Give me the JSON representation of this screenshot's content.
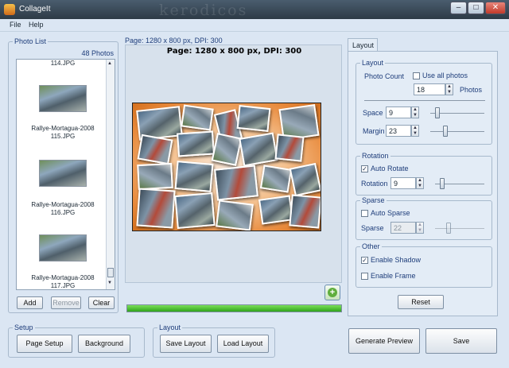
{
  "window": {
    "title": "CollageIt",
    "watermark": "kerodicos"
  },
  "menu": [
    "File",
    "Help"
  ],
  "photo_list": {
    "legend": "Photo List",
    "count": "48 Photos",
    "items": [
      {
        "line1": "",
        "line2": "114.JPG"
      },
      {
        "line1": "Rallye-Mortagua-2008",
        "line2": "115.JPG"
      },
      {
        "line1": "Rallye-Mortagua-2008",
        "line2": "116.JPG"
      },
      {
        "line1": "Rallye-Mortagua-2008",
        "line2": "117.JPG"
      }
    ],
    "add": "Add",
    "remove": "Remove",
    "clear": "Clear"
  },
  "preview": {
    "small_label": "Page: 1280 x 800 px, DPI: 300",
    "title": "Page: 1280 x 800 px, DPI: 300",
    "progress": 1.0
  },
  "tabs": [
    "Layout"
  ],
  "layout": {
    "legend": "Layout",
    "photo_count_label": "Photo Count",
    "use_all_label": "Use all photos",
    "use_all_checked": false,
    "count_value": "18",
    "photos_unit": "Photos",
    "space_label": "Space",
    "space_value": "9",
    "space_slider": 0.1,
    "margin_label": "Margin",
    "margin_value": "23",
    "margin_slider": 0.25
  },
  "rotation": {
    "legend": "Rotation",
    "auto_label": "Auto Rotate",
    "auto_checked": true,
    "rotation_label": "Rotation",
    "value": "9",
    "slider": 0.1
  },
  "sparse": {
    "legend": "Sparse",
    "auto_label": "Auto Sparse",
    "auto_checked": false,
    "sparse_label": "Sparse",
    "value": "22",
    "slider": 0.25
  },
  "other": {
    "legend": "Other",
    "shadow_label": "Enable Shadow",
    "shadow_checked": true,
    "frame_label": "Enable Frame",
    "frame_checked": false
  },
  "reset": "Reset",
  "setup": {
    "legend": "Setup",
    "page_setup": "Page Setup",
    "background": "Background"
  },
  "layout_box": {
    "legend": "Layout",
    "save": "Save Layout",
    "load": "Load Layout"
  },
  "generate": "Generate Preview",
  "save": "Save"
}
